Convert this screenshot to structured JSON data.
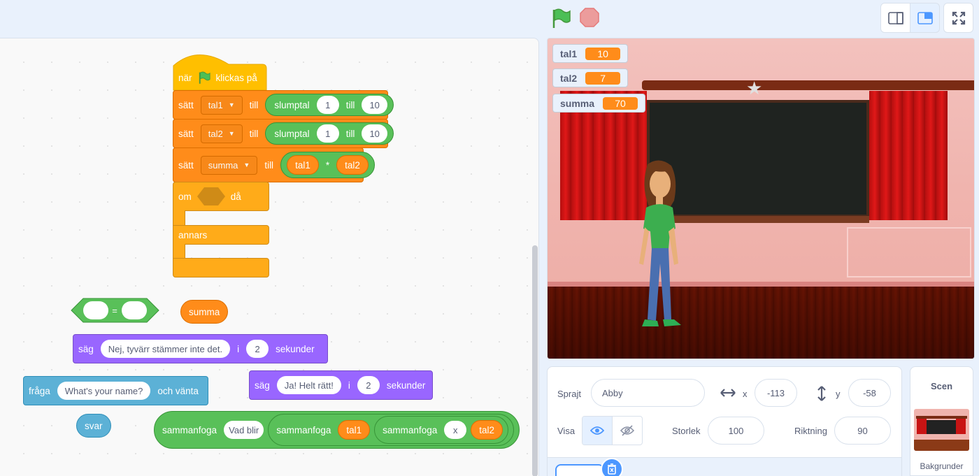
{
  "topbar": {
    "green_flag_icon": "green-flag-icon",
    "stop_icon": "stop-icon",
    "modes": [
      "small-stage-icon",
      "large-stage-icon",
      "fullscreen-icon"
    ]
  },
  "code": {
    "hat": {
      "when": "när",
      "clicked": "klickas på"
    },
    "set1": {
      "set": "sätt",
      "var": "tal1",
      "to": "till",
      "op": "slumptal",
      "from": "1",
      "to2": "till",
      "max": "10"
    },
    "set2": {
      "set": "sätt",
      "var": "tal2",
      "to": "till",
      "op": "slumptal",
      "from": "1",
      "to2": "till",
      "max": "10"
    },
    "set3": {
      "set": "sätt",
      "var": "summa",
      "to": "till",
      "a": "tal1",
      "mul": "*",
      "b": "tal2"
    },
    "ifelse": {
      "if": "om",
      "then": "då",
      "else": "annars"
    },
    "equals": {
      "sign": "="
    },
    "summa_reporter": "summa",
    "say1": {
      "say": "säg",
      "text": "Nej, tyvärr stämmer inte det.",
      "in": "i",
      "secs": "2",
      "unit": "sekunder"
    },
    "say2": {
      "say": "säg",
      "text": "Ja! Helt rätt!",
      "in": "i",
      "secs": "2",
      "unit": "sekunder"
    },
    "ask": {
      "ask": "fråga",
      "text": "What's your name?",
      "wait": "och vänta"
    },
    "answer": "svar",
    "join": {
      "join": "sammanfoga",
      "text": "Vad blir",
      "join2": "sammanfoga",
      "a": "tal1",
      "join3": "sammanfoga",
      "x": "x",
      "b": "tal2"
    }
  },
  "stage": {
    "monitors": [
      {
        "name": "tal1",
        "value": "10"
      },
      {
        "name": "tal2",
        "value": "7"
      },
      {
        "name": "summa",
        "value": "70"
      }
    ]
  },
  "sprite_info": {
    "sprite_label": "Sprajt",
    "sprite_name": "Abby",
    "x_label": "x",
    "x_value": "-113",
    "y_label": "y",
    "y_value": "-58",
    "show_label": "Visa",
    "size_label": "Storlek",
    "size_value": "100",
    "direction_label": "Riktning",
    "direction_value": "90"
  },
  "scene": {
    "title": "Scen",
    "backdrops_label": "Bakgrunder"
  },
  "colors": {
    "events": "#ffbf00",
    "variables": "#ff8c1a",
    "control": "#ffab19",
    "operators": "#59c059",
    "looks": "#9966ff",
    "sensing": "#5cb1d6",
    "accent": "#4c97ff"
  }
}
